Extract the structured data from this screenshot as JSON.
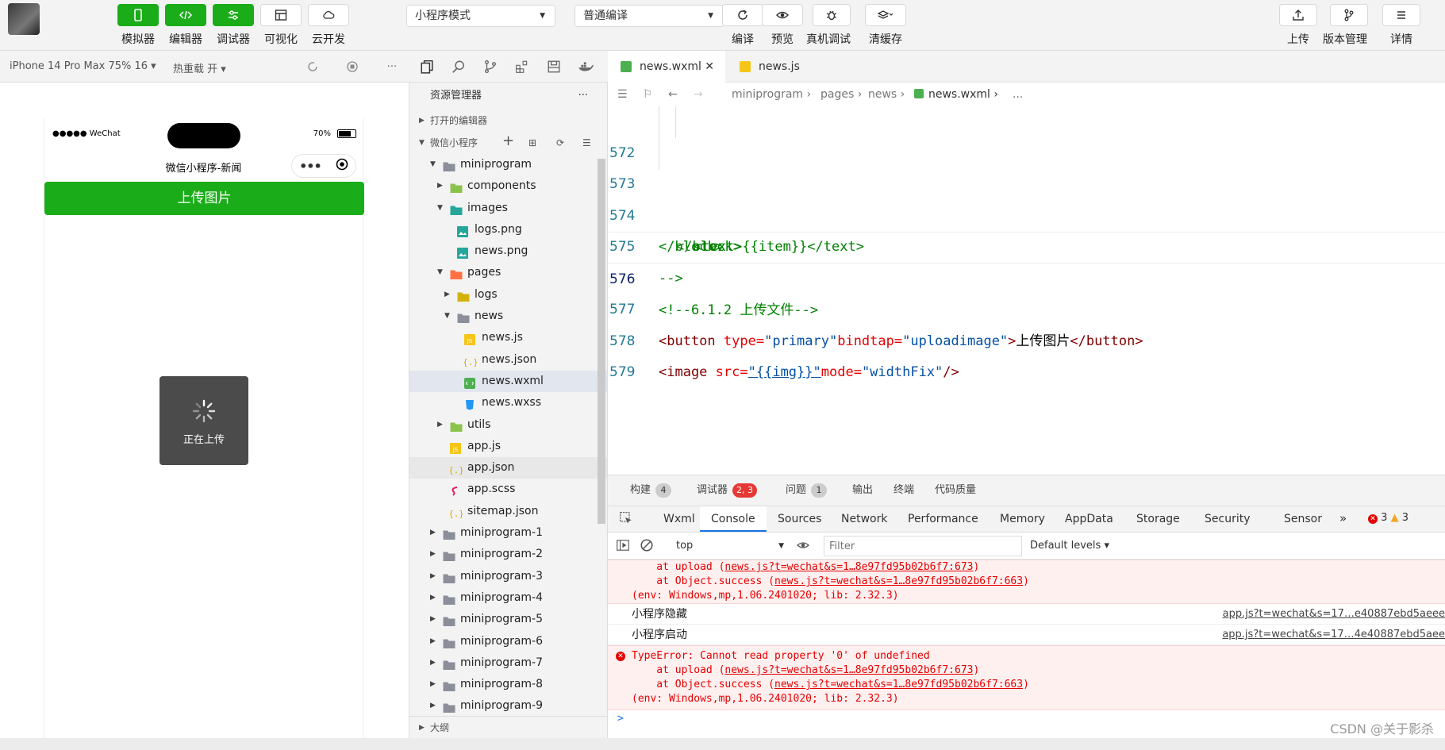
{
  "toolbar": {
    "left_buttons": [
      "模拟器",
      "编辑器",
      "调试器",
      "可视化",
      "云开发"
    ],
    "mode_select": "小程序模式",
    "compile_select": "普通编译",
    "mid_buttons": [
      "编译",
      "预览",
      "真机调试",
      "清缓存"
    ],
    "right_buttons": [
      "上传",
      "版本管理",
      "详情"
    ],
    "accent": "#1aad19"
  },
  "subbar": {
    "device": "iPhone 14 Pro Max 75% 16",
    "hot_reload": "热重载 开"
  },
  "simulator": {
    "carrier": "●●●●● WeChat",
    "battery_pct": "70%",
    "nav_title": "微信小程序-新闻",
    "upload_button": "上传图片",
    "toast_text": "正在上传"
  },
  "explorer": {
    "title": "资源管理器",
    "open_editors": "打开的编辑器",
    "project": "微信小程序",
    "outline": "大纲",
    "tree": [
      {
        "name": "miniprogram",
        "depth": 0,
        "type": "folder",
        "expanded": true
      },
      {
        "name": "components",
        "depth": 1,
        "type": "folder-green",
        "expanded": false
      },
      {
        "name": "images",
        "depth": 1,
        "type": "folder-teal",
        "expanded": true
      },
      {
        "name": "logs.png",
        "depth": 2,
        "type": "image"
      },
      {
        "name": "news.png",
        "depth": 2,
        "type": "image"
      },
      {
        "name": "pages",
        "depth": 1,
        "type": "folder-orange",
        "expanded": true
      },
      {
        "name": "logs",
        "depth": 2,
        "type": "folder-yellow",
        "expanded": false
      },
      {
        "name": "news",
        "depth": 2,
        "type": "folder",
        "expanded": true
      },
      {
        "name": "news.js",
        "depth": 3,
        "type": "js"
      },
      {
        "name": "news.json",
        "depth": 3,
        "type": "json"
      },
      {
        "name": "news.wxml",
        "depth": 3,
        "type": "wxml",
        "selected": true
      },
      {
        "name": "news.wxss",
        "depth": 3,
        "type": "css"
      },
      {
        "name": "utils",
        "depth": 1,
        "type": "folder-green",
        "expanded": false
      },
      {
        "name": "app.js",
        "depth": 1,
        "type": "js"
      },
      {
        "name": "app.json",
        "depth": 1,
        "type": "json",
        "hover": true
      },
      {
        "name": "app.scss",
        "depth": 1,
        "type": "scss"
      },
      {
        "name": "sitemap.json",
        "depth": 1,
        "type": "json"
      },
      {
        "name": "miniprogram-1",
        "depth": 0,
        "type": "folder",
        "expanded": false
      },
      {
        "name": "miniprogram-2",
        "depth": 0,
        "type": "folder",
        "expanded": false
      },
      {
        "name": "miniprogram-3",
        "depth": 0,
        "type": "folder",
        "expanded": false
      },
      {
        "name": "miniprogram-4",
        "depth": 0,
        "type": "folder",
        "expanded": false
      },
      {
        "name": "miniprogram-5",
        "depth": 0,
        "type": "folder",
        "expanded": false
      },
      {
        "name": "miniprogram-6",
        "depth": 0,
        "type": "folder",
        "expanded": false
      },
      {
        "name": "miniprogram-7",
        "depth": 0,
        "type": "folder",
        "expanded": false
      },
      {
        "name": "miniprogram-8",
        "depth": 0,
        "type": "folder",
        "expanded": false
      },
      {
        "name": "miniprogram-9",
        "depth": 0,
        "type": "folder",
        "expanded": false
      }
    ]
  },
  "editor": {
    "tabs": [
      {
        "name": "news.wxml",
        "active": true
      },
      {
        "name": "news.js",
        "active": false
      }
    ],
    "breadcrumb": [
      "miniprogram",
      "pages",
      "news",
      "news.wxml",
      "..."
    ],
    "lines": [
      {
        "n": "572",
        "indent": 2
      },
      {
        "n": "573",
        "indent": 1
      },
      {
        "n": "574",
        "indent": 0
      },
      {
        "n": "575",
        "indent": 0
      },
      {
        "n": "576",
        "indent": 0,
        "current": true
      },
      {
        "n": "577",
        "indent": 0
      },
      {
        "n": "578",
        "indent": 0
      },
      {
        "n": "579",
        "indent": 0
      }
    ],
    "code": {
      "l572": "<text>{{item}}</text>",
      "l573": "</block>",
      "l574": "</block>",
      "l575": "-->",
      "l576": "<!--6.1.2 上传文件-->",
      "l577_tag_open": "<button",
      "l577_attr1": "type=",
      "l577_val1": "\"primary\"",
      "l577_attr2": "bindtap=",
      "l577_val2": "\"uploadimage\"",
      "l577_close": ">",
      "l577_text": "上传图片",
      "l577_end": "</button>",
      "l578_tag_open": "<image",
      "l578_attr1": "src=",
      "l578_val1": "\"{{img}}\"",
      "l578_attr2": "mode=",
      "l578_val2": "\"widthFix\"",
      "l578_end": "/>"
    }
  },
  "debug": {
    "tabs": [
      {
        "label": "构建",
        "badge": "4",
        "badge_style": "gray"
      },
      {
        "label": "调试器",
        "badge": "2, 3",
        "badge_style": "red",
        "active": true
      },
      {
        "label": "问题",
        "badge": "1",
        "badge_style": "gray"
      },
      {
        "label": "输出"
      },
      {
        "label": "终端"
      },
      {
        "label": "代码质量"
      }
    ],
    "devtools_tabs": [
      "Wxml",
      "Console",
      "Sources",
      "Network",
      "Performance",
      "Memory",
      "AppData",
      "Storage",
      "Security",
      "Sensor"
    ],
    "active_devtool": "Console",
    "error_count": "3",
    "warn_count": "3",
    "context": "top",
    "filter_placeholder": "Filter",
    "levels": "Default levels",
    "messages": {
      "err1_l1": "    at upload (",
      "err1_l1_link": "news.js?t=wechat&s=1…8e97fd95b02b6f7:673",
      "err1_l2": "    at Object.success (",
      "err1_l2_link": "news.js?t=wechat&s=1…8e97fd95b02b6f7:663",
      "err1_l3": "(env: Windows,mp,1.06.2401020; lib: 2.32.3)",
      "log1": "小程序隐藏",
      "log1_src": "app.js?t=wechat&s=17…e40887ebd5aeee",
      "log2": "小程序启动",
      "log2_src": "app.js?t=wechat&s=17…4e40887ebd5aee",
      "err2_l0": "TypeError: Cannot read property '0' of undefined",
      "err2_l1": "    at upload (",
      "err2_l1_link": "news.js?t=wechat&s=1…8e97fd95b02b6f7:673",
      "err2_l2": "    at Object.success (",
      "err2_l2_link": "news.js?t=wechat&s=1…8e97fd95b02b6f7:663",
      "err2_l3": "(env: Windows,mp,1.06.2401020; lib: 2.32.3)",
      "prompt": ">"
    }
  },
  "watermark": "CSDN @关于影杀"
}
